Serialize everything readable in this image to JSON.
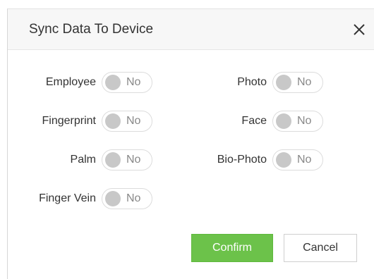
{
  "dialog": {
    "title": "Sync Data To Device",
    "close_glyph": "close-icon"
  },
  "fields": {
    "employee": {
      "label": "Employee",
      "value": "No"
    },
    "fingerprint": {
      "label": "Fingerprint",
      "value": "No"
    },
    "palm": {
      "label": "Palm",
      "value": "No"
    },
    "finger_vein": {
      "label": "Finger Vein",
      "value": "No"
    },
    "photo": {
      "label": "Photo",
      "value": "No"
    },
    "face": {
      "label": "Face",
      "value": "No"
    },
    "bio_photo": {
      "label": "Bio-Photo",
      "value": "No"
    }
  },
  "buttons": {
    "confirm_label": "Confirm",
    "cancel_label": "Cancel"
  },
  "colors": {
    "confirm_bg": "#6cc24a",
    "header_bg": "#f7f7f7",
    "toggle_knob": "#c8c8c8",
    "toggle_text": "#888888"
  }
}
